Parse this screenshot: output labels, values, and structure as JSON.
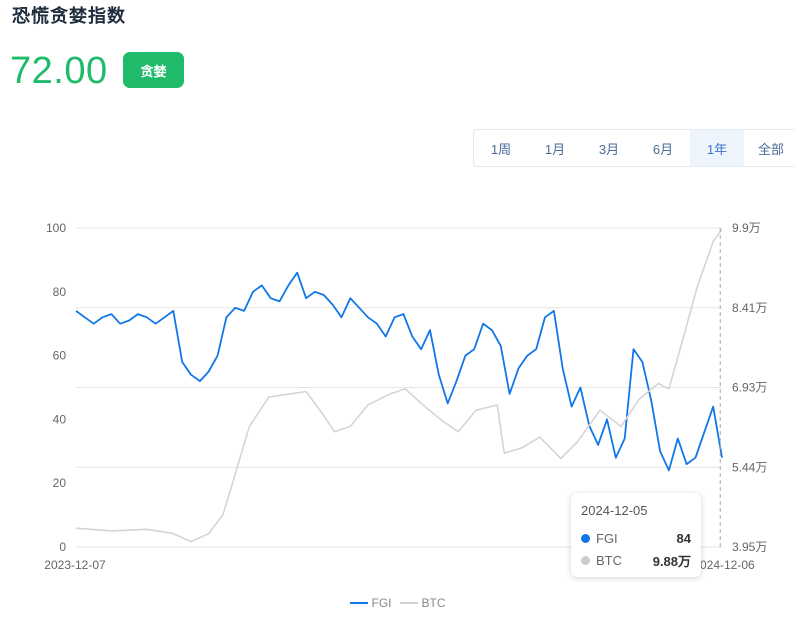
{
  "header": {
    "title": "恐慌贪婪指数",
    "value": "72.00",
    "badge": "贪婪",
    "badge_color": "#1fbb6a"
  },
  "range_tabs": {
    "items": [
      "1周",
      "1月",
      "3月",
      "6月",
      "1年",
      "全部"
    ],
    "active": "1年"
  },
  "tooltip": {
    "date": "2024-12-05",
    "rows": [
      {
        "name": "FGI",
        "value": "84",
        "color": "#1177e8"
      },
      {
        "name": "BTC",
        "value": "9.88万",
        "color": "#cccccc"
      }
    ]
  },
  "legend": [
    {
      "name": "FGI",
      "color": "#1177e8"
    },
    {
      "name": "BTC",
      "color": "#d5d5d5"
    }
  ],
  "chart_data": {
    "type": "line",
    "x_labels": [
      "2023-12-07",
      "2024-12-06"
    ],
    "x_range": [
      "2023-12-07",
      "2024-12-06"
    ],
    "y_left": {
      "ticks": [
        0,
        20,
        40,
        60,
        80,
        100
      ],
      "range": [
        0,
        100
      ]
    },
    "y_right": {
      "tick_labels": [
        "3.95万",
        "5.44万",
        "6.93万",
        "8.41万",
        "9.9万"
      ],
      "range": [
        39500,
        99000
      ]
    },
    "grid": true,
    "legend_position": "bottom",
    "series": [
      {
        "name": "FGI",
        "axis": "left",
        "color": "#1177e8",
        "x": [
          "2023-12-07",
          "2023-12-12",
          "2023-12-17",
          "2023-12-22",
          "2023-12-27",
          "2024-01-01",
          "2024-01-06",
          "2024-01-11",
          "2024-01-16",
          "2024-01-21",
          "2024-01-26",
          "2024-01-31",
          "2024-02-05",
          "2024-02-10",
          "2024-02-15",
          "2024-02-20",
          "2024-02-25",
          "2024-03-01",
          "2024-03-06",
          "2024-03-11",
          "2024-03-16",
          "2024-03-21",
          "2024-03-26",
          "2024-03-31",
          "2024-04-05",
          "2024-04-10",
          "2024-04-15",
          "2024-04-20",
          "2024-04-25",
          "2024-04-30",
          "2024-05-05",
          "2024-05-10",
          "2024-05-15",
          "2024-05-20",
          "2024-05-25",
          "2024-05-30",
          "2024-06-04",
          "2024-06-09",
          "2024-06-14",
          "2024-06-19",
          "2024-06-24",
          "2024-06-29",
          "2024-07-04",
          "2024-07-09",
          "2024-07-14",
          "2024-07-19",
          "2024-07-24",
          "2024-07-29",
          "2024-08-03",
          "2024-08-08",
          "2024-08-13",
          "2024-08-18",
          "2024-08-23",
          "2024-08-28",
          "2024-09-02",
          "2024-09-07",
          "2024-09-12",
          "2024-09-17",
          "2024-09-22",
          "2024-09-27",
          "2024-10-02",
          "2024-10-07",
          "2024-10-12",
          "2024-10-17",
          "2024-10-22",
          "2024-10-27",
          "2024-11-01",
          "2024-11-06",
          "2024-11-11",
          "2024-11-16",
          "2024-11-21",
          "2024-11-26",
          "2024-12-01",
          "2024-12-06"
        ],
        "y": [
          74,
          72,
          70,
          72,
          73,
          70,
          71,
          73,
          72,
          70,
          72,
          74,
          58,
          54,
          52,
          55,
          60,
          72,
          75,
          74,
          80,
          82,
          78,
          77,
          82,
          86,
          78,
          80,
          79,
          76,
          72,
          78,
          75,
          72,
          70,
          66,
          72,
          73,
          66,
          62,
          68,
          54,
          45,
          52,
          60,
          62,
          70,
          68,
          63,
          48,
          56,
          60,
          62,
          72,
          74,
          56,
          44,
          50,
          38,
          32,
          40,
          28,
          34,
          62,
          58,
          46,
          30,
          24,
          34,
          26,
          28,
          36,
          44,
          28
        ],
        "note": "y values sampled along the plotted line; final value 72"
      },
      {
        "name": "BTC",
        "axis": "right",
        "color": "#d5d5d5",
        "x": [
          "2023-12-07",
          "2023-12-27",
          "2024-01-16",
          "2024-01-31",
          "2024-02-10",
          "2024-02-20",
          "2024-02-28",
          "2024-03-05",
          "2024-03-14",
          "2024-03-25",
          "2024-04-05",
          "2024-04-15",
          "2024-04-25",
          "2024-05-01",
          "2024-05-10",
          "2024-05-20",
          "2024-06-01",
          "2024-06-10",
          "2024-06-20",
          "2024-07-01",
          "2024-07-10",
          "2024-07-20",
          "2024-08-01",
          "2024-08-05",
          "2024-08-15",
          "2024-08-25",
          "2024-09-06",
          "2024-09-15",
          "2024-09-28",
          "2024-10-10",
          "2024-10-20",
          "2024-10-31",
          "2024-11-06",
          "2024-11-12",
          "2024-11-22",
          "2024-12-01",
          "2024-12-06"
        ],
        "y": [
          43000,
          42500,
          42800,
          42000,
          40500,
          42000,
          45500,
          52000,
          62000,
          67500,
          68000,
          68500,
          64000,
          61000,
          62000,
          66000,
          68000,
          69000,
          66000,
          63000,
          61000,
          65000,
          66000,
          57000,
          58000,
          60000,
          56000,
          59000,
          65000,
          62000,
          67000,
          70000,
          69000,
          76000,
          88000,
          96500,
          98800
        ],
        "note": "y values in USD, estimated from right axis"
      }
    ],
    "cursor": {
      "x": "2024-12-05"
    }
  }
}
